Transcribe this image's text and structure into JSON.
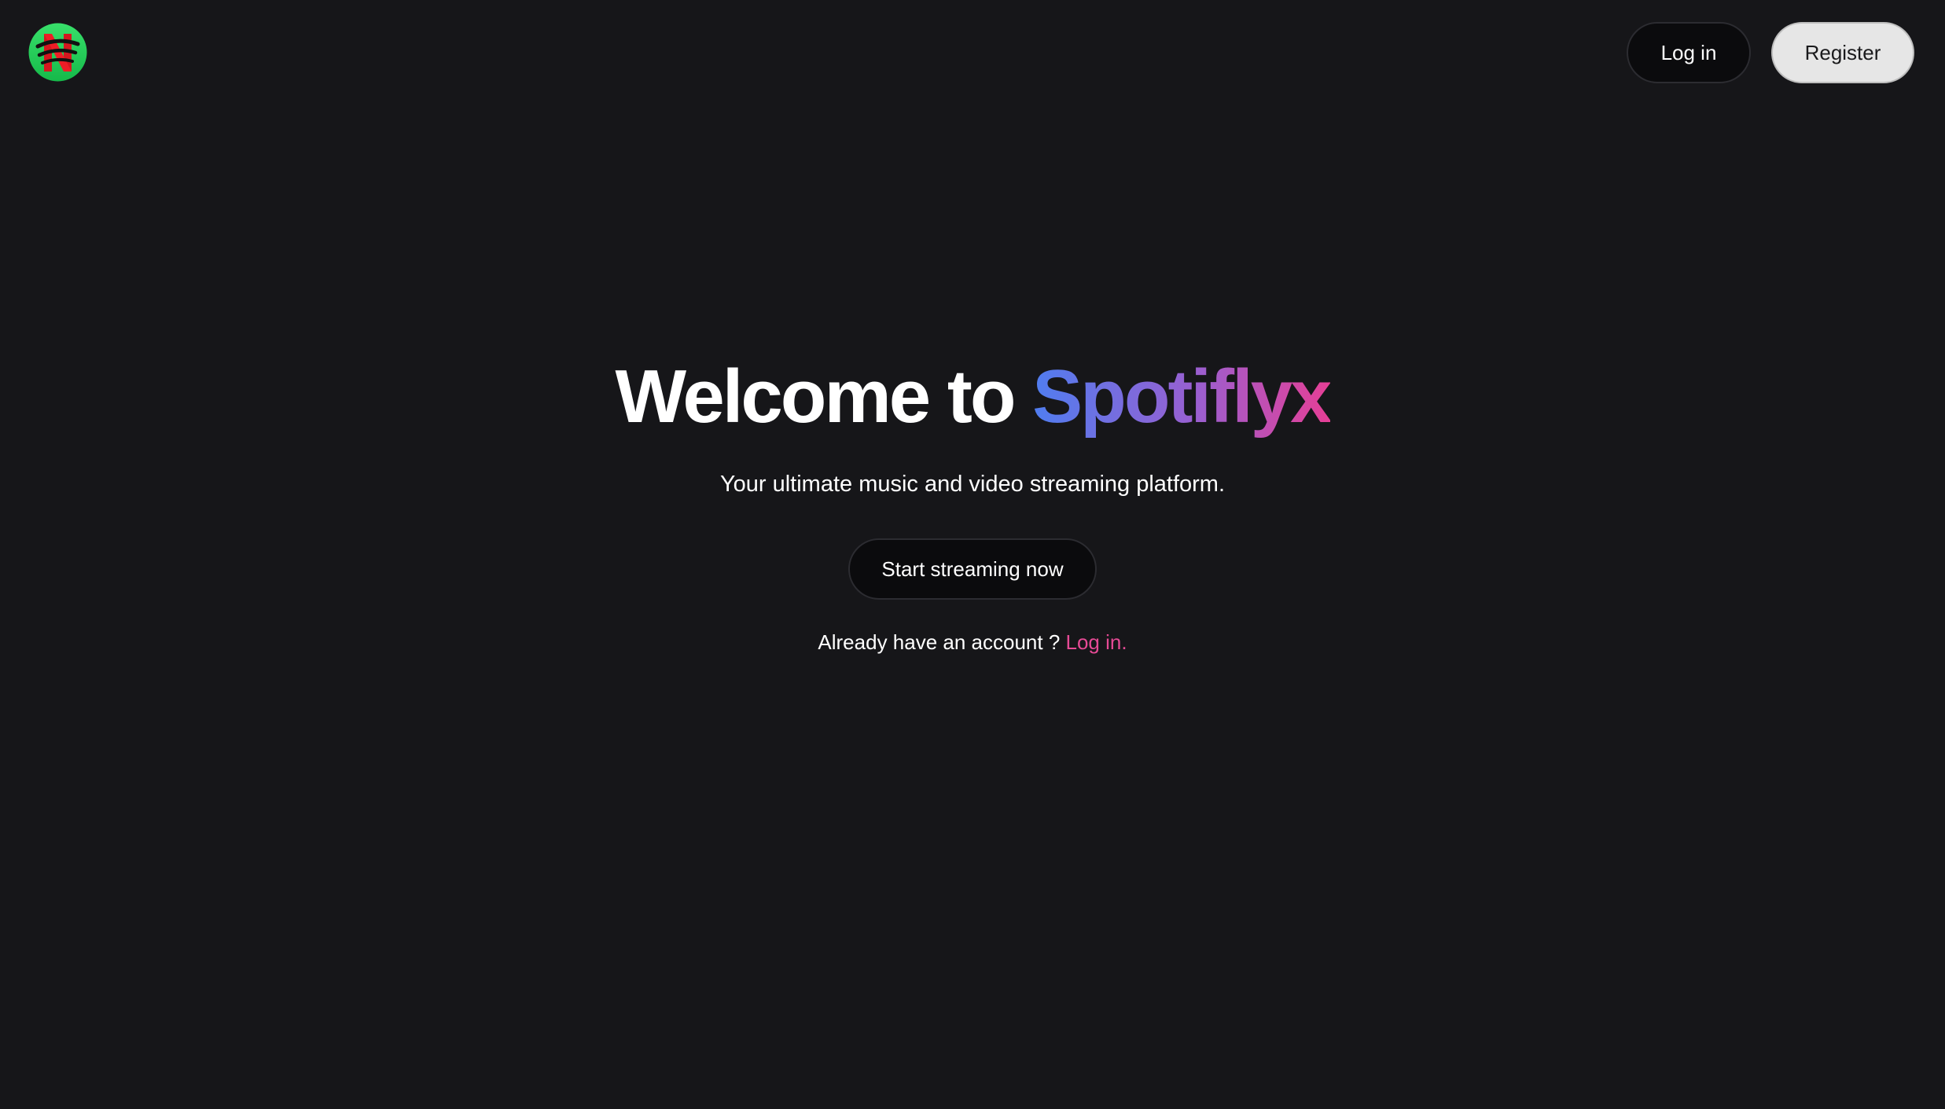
{
  "header": {
    "logo_icon": "spotiflyx-logo-icon",
    "login_label": "Log in",
    "register_label": "Register"
  },
  "hero": {
    "title_prefix": "Welcome to",
    "brand_name": "Spotiflyx",
    "subtitle": "Your ultimate music and video streaming platform.",
    "cta_label": "Start streaming now",
    "account_prompt": "Already have an account ?",
    "account_link": "Log in."
  },
  "colors": {
    "background": "#161619",
    "brand_gradient_start": "#4f7df0",
    "brand_gradient_mid": "#9a5fd0",
    "brand_gradient_end": "#e63f96",
    "link": "#e64a95",
    "dark_button": "#0b0b0d",
    "light_button": "#e6e6e6"
  }
}
